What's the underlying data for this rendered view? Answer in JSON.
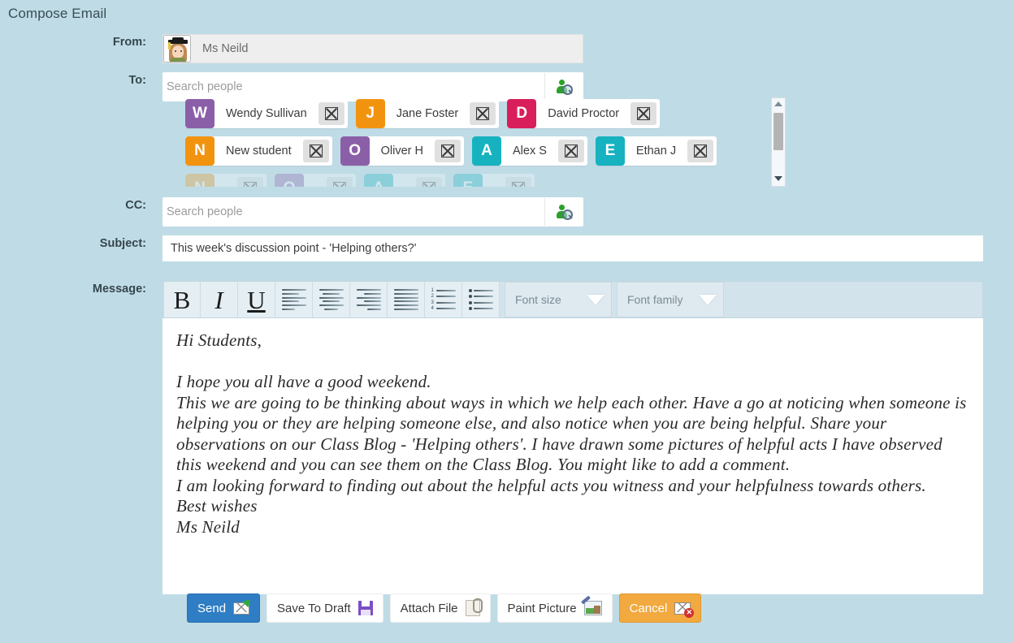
{
  "page": {
    "title": "Compose Email"
  },
  "form": {
    "from": {
      "label": "From:",
      "value": "Ms Neild",
      "avatar_icon": "student-avatar-icon"
    },
    "to": {
      "label": "To:",
      "placeholder": "Search people",
      "value": "",
      "search_icon": "person-search-icon"
    },
    "cc": {
      "label": "CC:",
      "placeholder": "Search people",
      "value": "",
      "search_icon": "person-search-icon"
    },
    "subject": {
      "label": "Subject:",
      "value": "This week's discussion point - 'Helping others?'",
      "placeholder": ""
    },
    "message": {
      "label": "Message:"
    }
  },
  "recipients": [
    {
      "initial": "W",
      "name": "Wendy Sullivan",
      "color": "#8b5fa8"
    },
    {
      "initial": "J",
      "name": "Jane Foster",
      "color": "#f29310"
    },
    {
      "initial": "D",
      "name": "David Proctor",
      "color": "#d81e5b"
    },
    {
      "initial": "N",
      "name": "New student",
      "color": "#f29310"
    },
    {
      "initial": "O",
      "name": "Oliver H",
      "color": "#8b5fa8"
    },
    {
      "initial": "A",
      "name": "Alex S",
      "color": "#17b2c0"
    },
    {
      "initial": "E",
      "name": "Ethan J",
      "color": "#17b2c0"
    }
  ],
  "recipients_ghost_row": [
    {
      "initial": "N",
      "color": "#f29310"
    },
    {
      "initial": "O",
      "color": "#8b5fa8"
    },
    {
      "initial": "A",
      "color": "#17b2c0"
    },
    {
      "initial": "E",
      "color": "#17b2c0"
    }
  ],
  "remove_label": "X",
  "toolbar": {
    "bold": "B",
    "italic": "I",
    "underline": "U",
    "align_left_icon": "align-left-icon",
    "align_center_icon": "align-center-icon",
    "align_right_icon": "align-right-icon",
    "align_justify_icon": "align-justify-icon",
    "ordered_list_icon": "ordered-list-icon",
    "unordered_list_icon": "unordered-list-icon",
    "font_size": "Font size",
    "font_family": "Font family"
  },
  "body_text": "Hi Students,\n\nI hope you all have a good weekend.\nThis we are going to be thinking about ways in which we help each other. Have a go at noticing when someone is helping you or they are helping someone else, and also notice when you are being helpful. Share your observations on our Class Blog - 'Helping others'. I have drawn some pictures of helpful acts I have observed this weekend and you can see them on the Class Blog. You might like to add a comment.\nI am looking forward to finding out about the helpful acts you witness and your helpfulness towards others.\nBest wishes\nMs Neild",
  "actions": [
    {
      "label": "Send",
      "style": "primary",
      "icon": "send-envelope-icon"
    },
    {
      "label": "Save To Draft",
      "style": "plain",
      "icon": "floppy-disk-icon"
    },
    {
      "label": "Attach File",
      "style": "plain",
      "icon": "paperclip-icon"
    },
    {
      "label": "Paint Picture",
      "style": "plain",
      "icon": "paint-image-icon"
    },
    {
      "label": "Cancel",
      "style": "warn",
      "icon": "cancel-envelope-icon"
    }
  ],
  "colors": {
    "background": "#bfdce6",
    "send_button": "#2f7dc4",
    "cancel_button": "#f2a93f",
    "toolbar_bg": "#d3e3ec"
  }
}
